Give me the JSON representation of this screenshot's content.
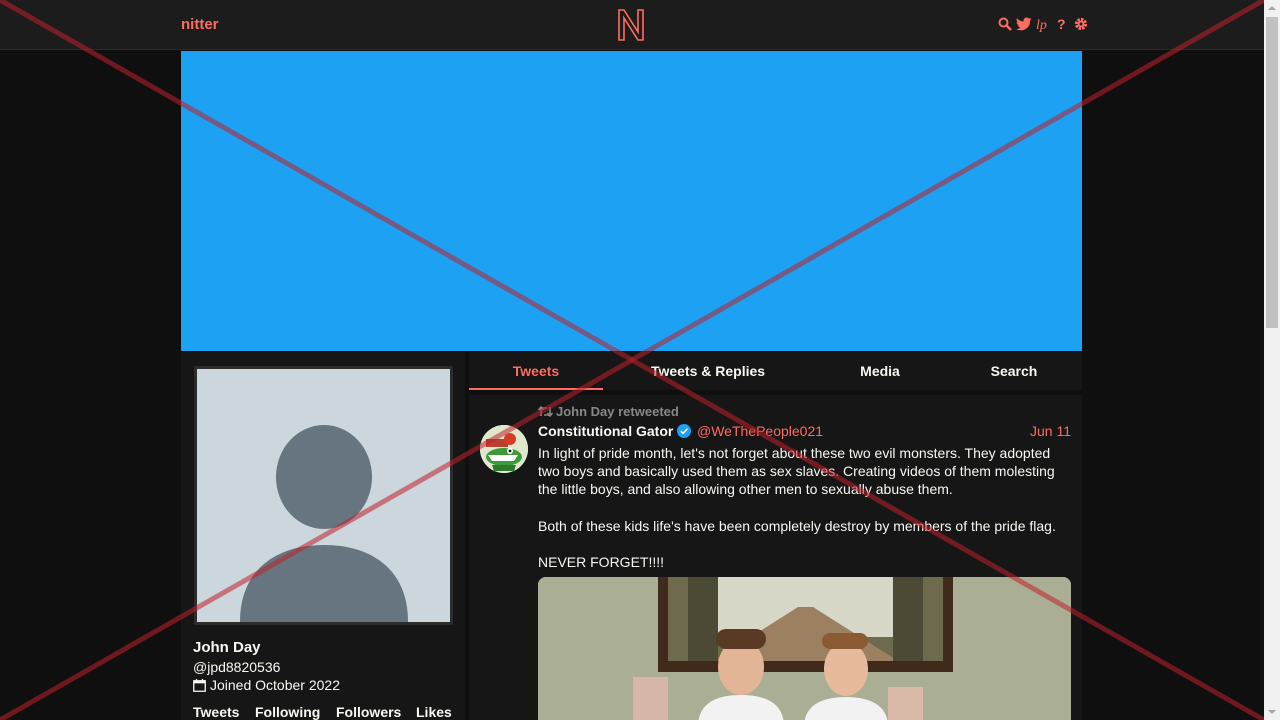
{
  "navbar": {
    "brand": "nitter",
    "logo_letter": "N",
    "icons": [
      "search-icon",
      "bird-icon",
      "lp-icon",
      "help-icon",
      "gear-icon"
    ]
  },
  "colors": {
    "accent": "#ff6c60",
    "banner": "#1da1f2",
    "background": "#0f0f0f",
    "panel": "#161616",
    "overlay_cross": "#c0202a"
  },
  "profile": {
    "fullname": "John Day",
    "username": "@jpd8820536",
    "joined": "Joined October 2022",
    "stats": [
      "Tweets",
      "Following",
      "Followers",
      "Likes"
    ]
  },
  "tabs": [
    {
      "label": "Tweets",
      "active": true
    },
    {
      "label": "Tweets & Replies",
      "active": false
    },
    {
      "label": "Media",
      "active": false
    },
    {
      "label": "Search",
      "active": false
    }
  ],
  "tweet": {
    "retweet_label": "John Day retweeted",
    "fullname": "Constitutional Gator",
    "username": "@WeThePeople021",
    "date": "Jun 11",
    "verified": true,
    "text": "In light of pride month, let's not forget about these two evil monsters. They adopted two boys and basically used them as sex slaves. Creating videos of them molesting the little boys, and also allowing other men to sexually abuse them.\n\nBoth of these kids life's have been completely destroy by members of the pride flag.\n\nNEVER FORGET!!!!"
  }
}
